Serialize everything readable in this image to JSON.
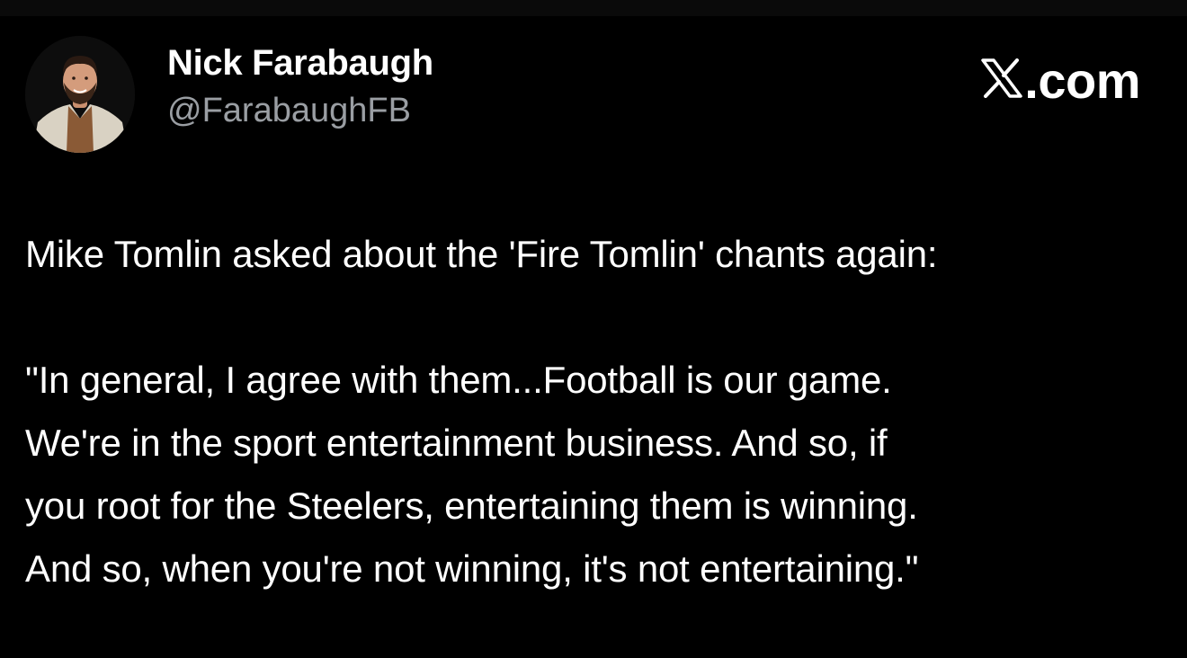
{
  "author": {
    "display_name": "Nick Farabaugh",
    "handle": "@FarabaughFB",
    "avatar": "profile-photo"
  },
  "brand": {
    "domain": ".com",
    "logo_icon": "x-logo-icon"
  },
  "post": {
    "lines": [
      "Mike Tomlin asked about the 'Fire Tomlin' chants again:",
      "\"In general, I agree with them...Football is our game.",
      "We're in the sport entertainment business. And so, if",
      "you root for the Steelers, entertaining them is winning.",
      "And so, when you're not winning, it's not entertaining.\""
    ]
  },
  "colors": {
    "background": "#000000",
    "text_primary": "#ffffff",
    "text_secondary": "#9a9ea3"
  }
}
